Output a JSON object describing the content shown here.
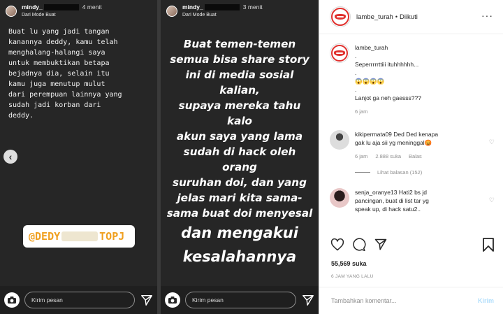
{
  "story1": {
    "username": "mindy_",
    "time": "4 menit",
    "subtitle": "Dari Mode Buat",
    "text": "Buat lu yang jadi tangan\nkanannya deddy, kamu telah\nmenghalang-halangi saya\nuntuk membuktikan betapa\nbejadnya dia, selain itu\nkamu juga menutup mulut\ndari perempuan lainnya yang\nsudah jadi korban dari\ndeddy.",
    "tag_left": "@DEDY",
    "tag_right": "TOPJ",
    "reply_placeholder": "Kirim pesan"
  },
  "story2": {
    "username": "mindy_",
    "time": "3 menit",
    "subtitle": "Dari Mode Buat",
    "lines": [
      "Buat temen-temen",
      "semua bisa share story",
      "ini di media sosial kalian,",
      "supaya mereka tahu kalo",
      "akun saya yang lama",
      "sudah di hack oleh orang",
      "suruhan doi, dan yang",
      "jelas mari kita sama-",
      "sama buat doi menyesal"
    ],
    "big_lines": [
      "dan mengakui",
      "kesalahannya"
    ],
    "reply_placeholder": "Kirim pesan"
  },
  "post": {
    "account": "lambe_turah",
    "dot": "•",
    "follow_status": "Diikuti",
    "caption": {
      "user": "lambe_turah",
      "lines": [
        ".",
        "Seperrrrrttiii ituhhhhhh...",
        ".",
        "😱😱😱😱",
        ".",
        "Lanjot ga neh gaesss???"
      ],
      "time": "6 jam"
    },
    "comments": [
      {
        "user": "kikipermata09",
        "lines": [
          "Ded Ded kenapa",
          "gak lu aja sii yg meninggal😡"
        ],
        "time": "6 jam",
        "likes": "2.888 suka",
        "reply": "Balas",
        "view_replies": "Lihat balasan (152)"
      },
      {
        "user": "senja_oranye13",
        "lines": [
          "Hati2 bs jd",
          "pancingan, buat di list tar yg",
          "speak up, di hack satu2.."
        ]
      }
    ],
    "likes": "55,569 suka",
    "posted_ago": "6 JAM YANG LALU",
    "add_comment_placeholder": "Tambahkan komentar...",
    "post_button": "Kirim"
  },
  "colors": {
    "brand_red": "#e0312e",
    "muted": "#8e8e8e",
    "link_disabled": "#b2dffc"
  }
}
